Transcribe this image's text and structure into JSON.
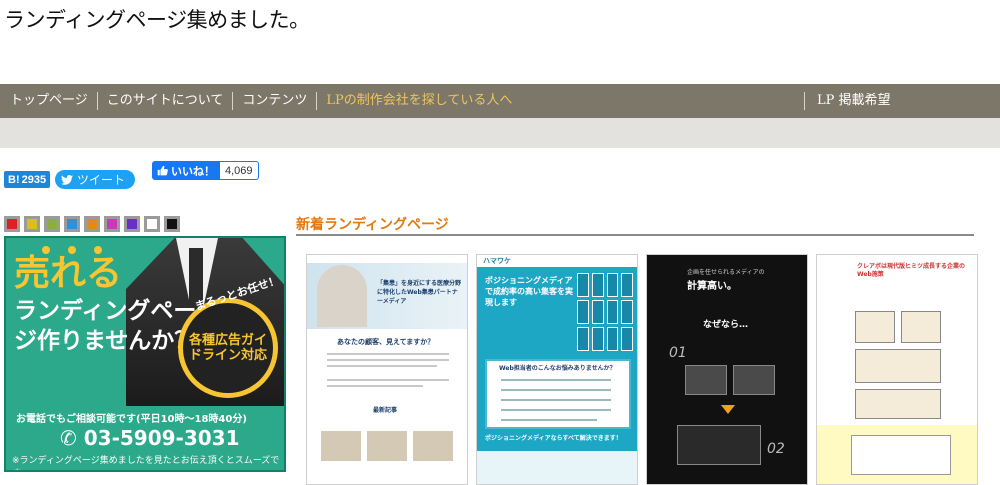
{
  "site_title": "ランディングページ集めました。",
  "nav": {
    "items": [
      "トップページ",
      "このサイトについて",
      "コンテンツ",
      "LPの制作会社を探している人へ"
    ],
    "right": "LP 掲載希望"
  },
  "share": {
    "hatena_icon": "B!",
    "hatena_count": "2935",
    "tweet_label": "ツイート",
    "like_label": "いいね！",
    "like_count": "4,069"
  },
  "color_swatches": [
    "#e02020",
    "#d8c020",
    "#8cae3e",
    "#2f8fd8",
    "#e08a18",
    "#c83ab8",
    "#6a2fc8",
    "#ffffff",
    "#111111"
  ],
  "ad": {
    "headline_1": "売れる",
    "headline_2": "ランディングページ作りませんか？",
    "badge_top": "まるっとお任せ！",
    "badge_text": "各種広告ガイドライン対応",
    "phone_label": "お電話でもご相談可能です(平日10時〜18時40分)",
    "phone": "03-5909-3031",
    "note": "※ランディングページ集めましたを見たとお伝え頂くとスムーズです。"
  },
  "section": {
    "title": "新着ランディングページ"
  },
  "thumbnails": {
    "t1": {
      "copy": "「集患」を身近にする医療分野に特化したWeb集患パートナーメディア",
      "question": "あなたの顧客、見えてますか？",
      "label": "最新記事"
    },
    "t2": {
      "logo": "ハマワケ",
      "headline": "ポジショニングメディアで成約率の高い集客を実現します",
      "box_title": "Web担当者のこんなお悩みありませんか？",
      "footer": "ポジショニングメディアならすべて解決できます！"
    },
    "t3": {
      "head": "企画を任せられるメディアの",
      "big": "計算高い。",
      "why": "なぜなら…",
      "num1": "01",
      "num2": "02"
    },
    "t4": {
      "head": "クレアボは現代版ヒミツ成長する企業のWeb施策"
    }
  }
}
